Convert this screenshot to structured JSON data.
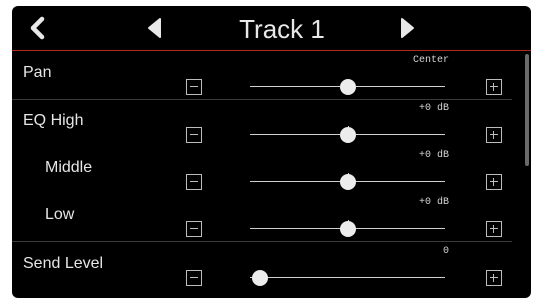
{
  "header": {
    "title": "Track 1",
    "back_icon": "chevron-left-icon",
    "prev_icon": "triangle-left-icon",
    "next_icon": "triangle-right-icon"
  },
  "rows": [
    {
      "id": "pan",
      "label": "Pan",
      "value_text": "Center",
      "level": 0.5,
      "tick": false
    },
    {
      "id": "eq-high",
      "label": "EQ High",
      "value_text": "+0 dB",
      "level": 0.5,
      "tick": true
    },
    {
      "id": "eq-middle",
      "label": "Middle",
      "value_text": "+0 dB",
      "level": 0.5,
      "tick": true
    },
    {
      "id": "eq-low",
      "label": "Low",
      "value_text": "+0 dB",
      "level": 0.5,
      "tick": true
    },
    {
      "id": "send-level",
      "label": "Send Level",
      "value_text": "0",
      "level": 0.0,
      "tick": false
    }
  ],
  "colors": {
    "accent_line": "#b52a1c",
    "background": "#000000",
    "foreground": "#e6e6e6"
  }
}
